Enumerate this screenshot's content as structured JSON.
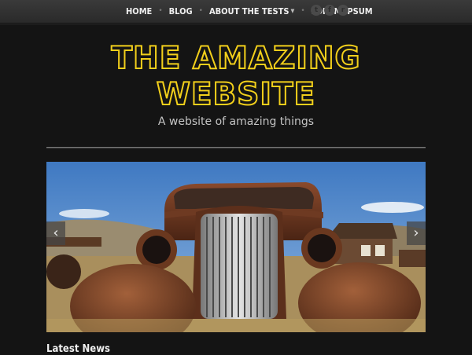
{
  "nav": {
    "items": [
      {
        "label": "HOME"
      },
      {
        "label": "BLOG"
      },
      {
        "label": "ABOUT THE TESTS",
        "has_dropdown": true
      },
      {
        "label": "LOREM IPSUM"
      }
    ],
    "socials": [
      {
        "icon": "twitter-icon",
        "glyph": "t"
      },
      {
        "icon": "facebook-icon",
        "glyph": "f"
      },
      {
        "icon": "feed-icon",
        "glyph": "r"
      }
    ]
  },
  "site": {
    "title": "The Amazing Website",
    "tagline": "A website of amazing things"
  },
  "slider": {
    "image": "rusted-vintage-car-photo",
    "prev_glyph": "‹",
    "next_glyph": "›"
  },
  "sections": {
    "latest_news": "Latest News"
  },
  "colors": {
    "background": "#141414",
    "title_outline": "#f2cf1b",
    "tagline": "#c4c4c4"
  }
}
